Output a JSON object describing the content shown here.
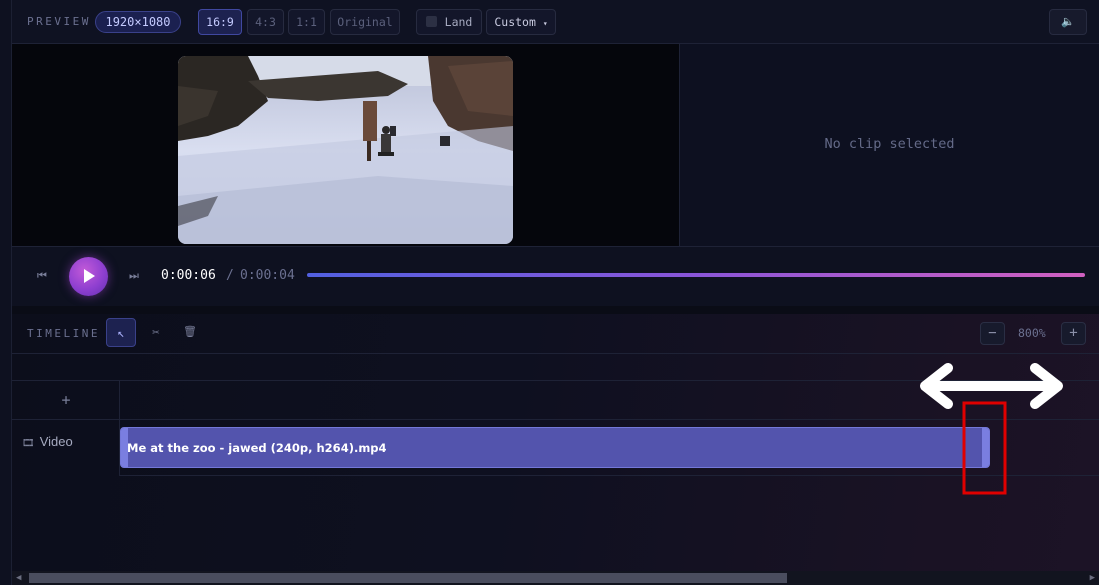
{
  "toolbar": {
    "label": "PREVIEW",
    "resolution": "1920×1080",
    "aspect_ratios": [
      "16:9",
      "4:3",
      "1:1",
      "Original"
    ],
    "active_aspect": "16:9",
    "orientation_label": "Land",
    "custom_label": "Custom",
    "custom_caret": "▾",
    "volume_icon": "speaker-icon",
    "volume_glyph": "🔈"
  },
  "inspector": {
    "empty_text": "No clip selected"
  },
  "playback": {
    "current_time": "0:00:06",
    "separator": "/",
    "duration": "0:00:04",
    "skip_back_glyph": "⏮",
    "skip_forward_glyph": "⏭"
  },
  "timeline": {
    "label": "TIMELINE",
    "tools": {
      "select_glyph": "↖",
      "cut_glyph": "✂",
      "delete_glyph": "🗑"
    },
    "zoom": {
      "minus": "−",
      "value": "800%",
      "plus": "+"
    },
    "add_track_glyph": "+",
    "tracks": [
      {
        "name": "Video",
        "icon": "film-icon",
        "clips": [
          {
            "title": "Me at the zoo - jawed (240p, h264).mp4"
          }
        ]
      }
    ],
    "scroll_left_glyph": "◀",
    "scroll_right_glyph": "▶"
  },
  "annotation": {
    "arrow_color": "#ffffff",
    "highlight_color": "#e00000"
  },
  "colors": {
    "accent": "#5354ad",
    "play_button": "#a04ad4",
    "scrubber_start": "#5260e0",
    "scrubber_end": "#d060c0"
  }
}
